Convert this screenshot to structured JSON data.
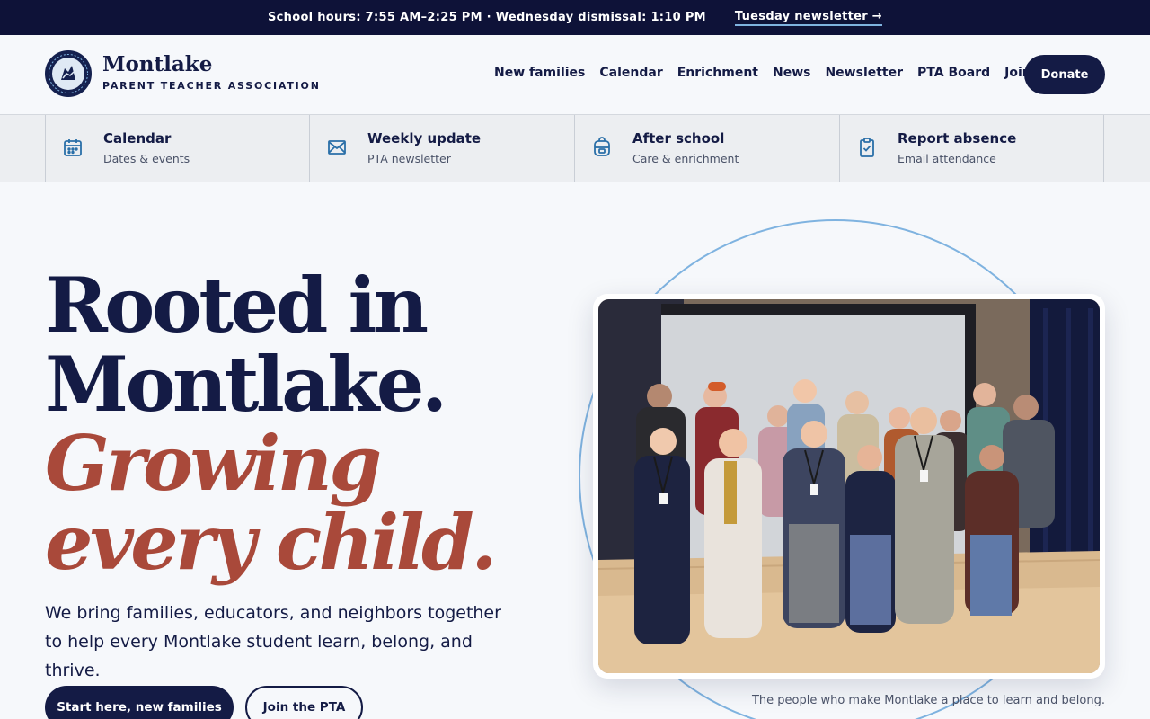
{
  "announcement": {
    "hours_text": "School hours: 7:55 AM–2:25 PM · Wednesday dismissal: 1:10 PM",
    "newsletter_link": "Tuesday newsletter →"
  },
  "brand": {
    "name": "Montlake",
    "subtitle": "PARENT TEACHER ASSOCIATION",
    "logo_icon": "school-seal-icon"
  },
  "nav": {
    "items": [
      "New families",
      "Calendar",
      "Enrichment",
      "News",
      "Newsletter",
      "PTA Board",
      "Join"
    ],
    "donate_label": "Donate"
  },
  "quick_links": [
    {
      "title": "Calendar",
      "subtitle": "Dates & events",
      "icon": "calendar-icon"
    },
    {
      "title": "Weekly update",
      "subtitle": "PTA newsletter",
      "icon": "envelope-icon"
    },
    {
      "title": "After school",
      "subtitle": "Care & enrichment",
      "icon": "backpack-icon"
    },
    {
      "title": "Report absence",
      "subtitle": "Email attendance",
      "icon": "clipboard-check-icon"
    }
  ],
  "hero": {
    "line1": "Rooted in",
    "line2": "Montlake.",
    "line3": "Growing",
    "line4": "every child.",
    "lede": "We bring families, educators, and neighbors together to help every Montlake student learn, belong, and thrive.",
    "primary_cta": "Start here, new families",
    "secondary_cta": "Join the PTA",
    "photo_caption": "The people who make Montlake a place to learn and belong."
  },
  "colors": {
    "navy": "#141b45",
    "announce_bg": "#0e1238",
    "accent_red": "#a9493a",
    "arc_blue": "#7fb3e0",
    "icon_blue": "#2a6fa8"
  }
}
